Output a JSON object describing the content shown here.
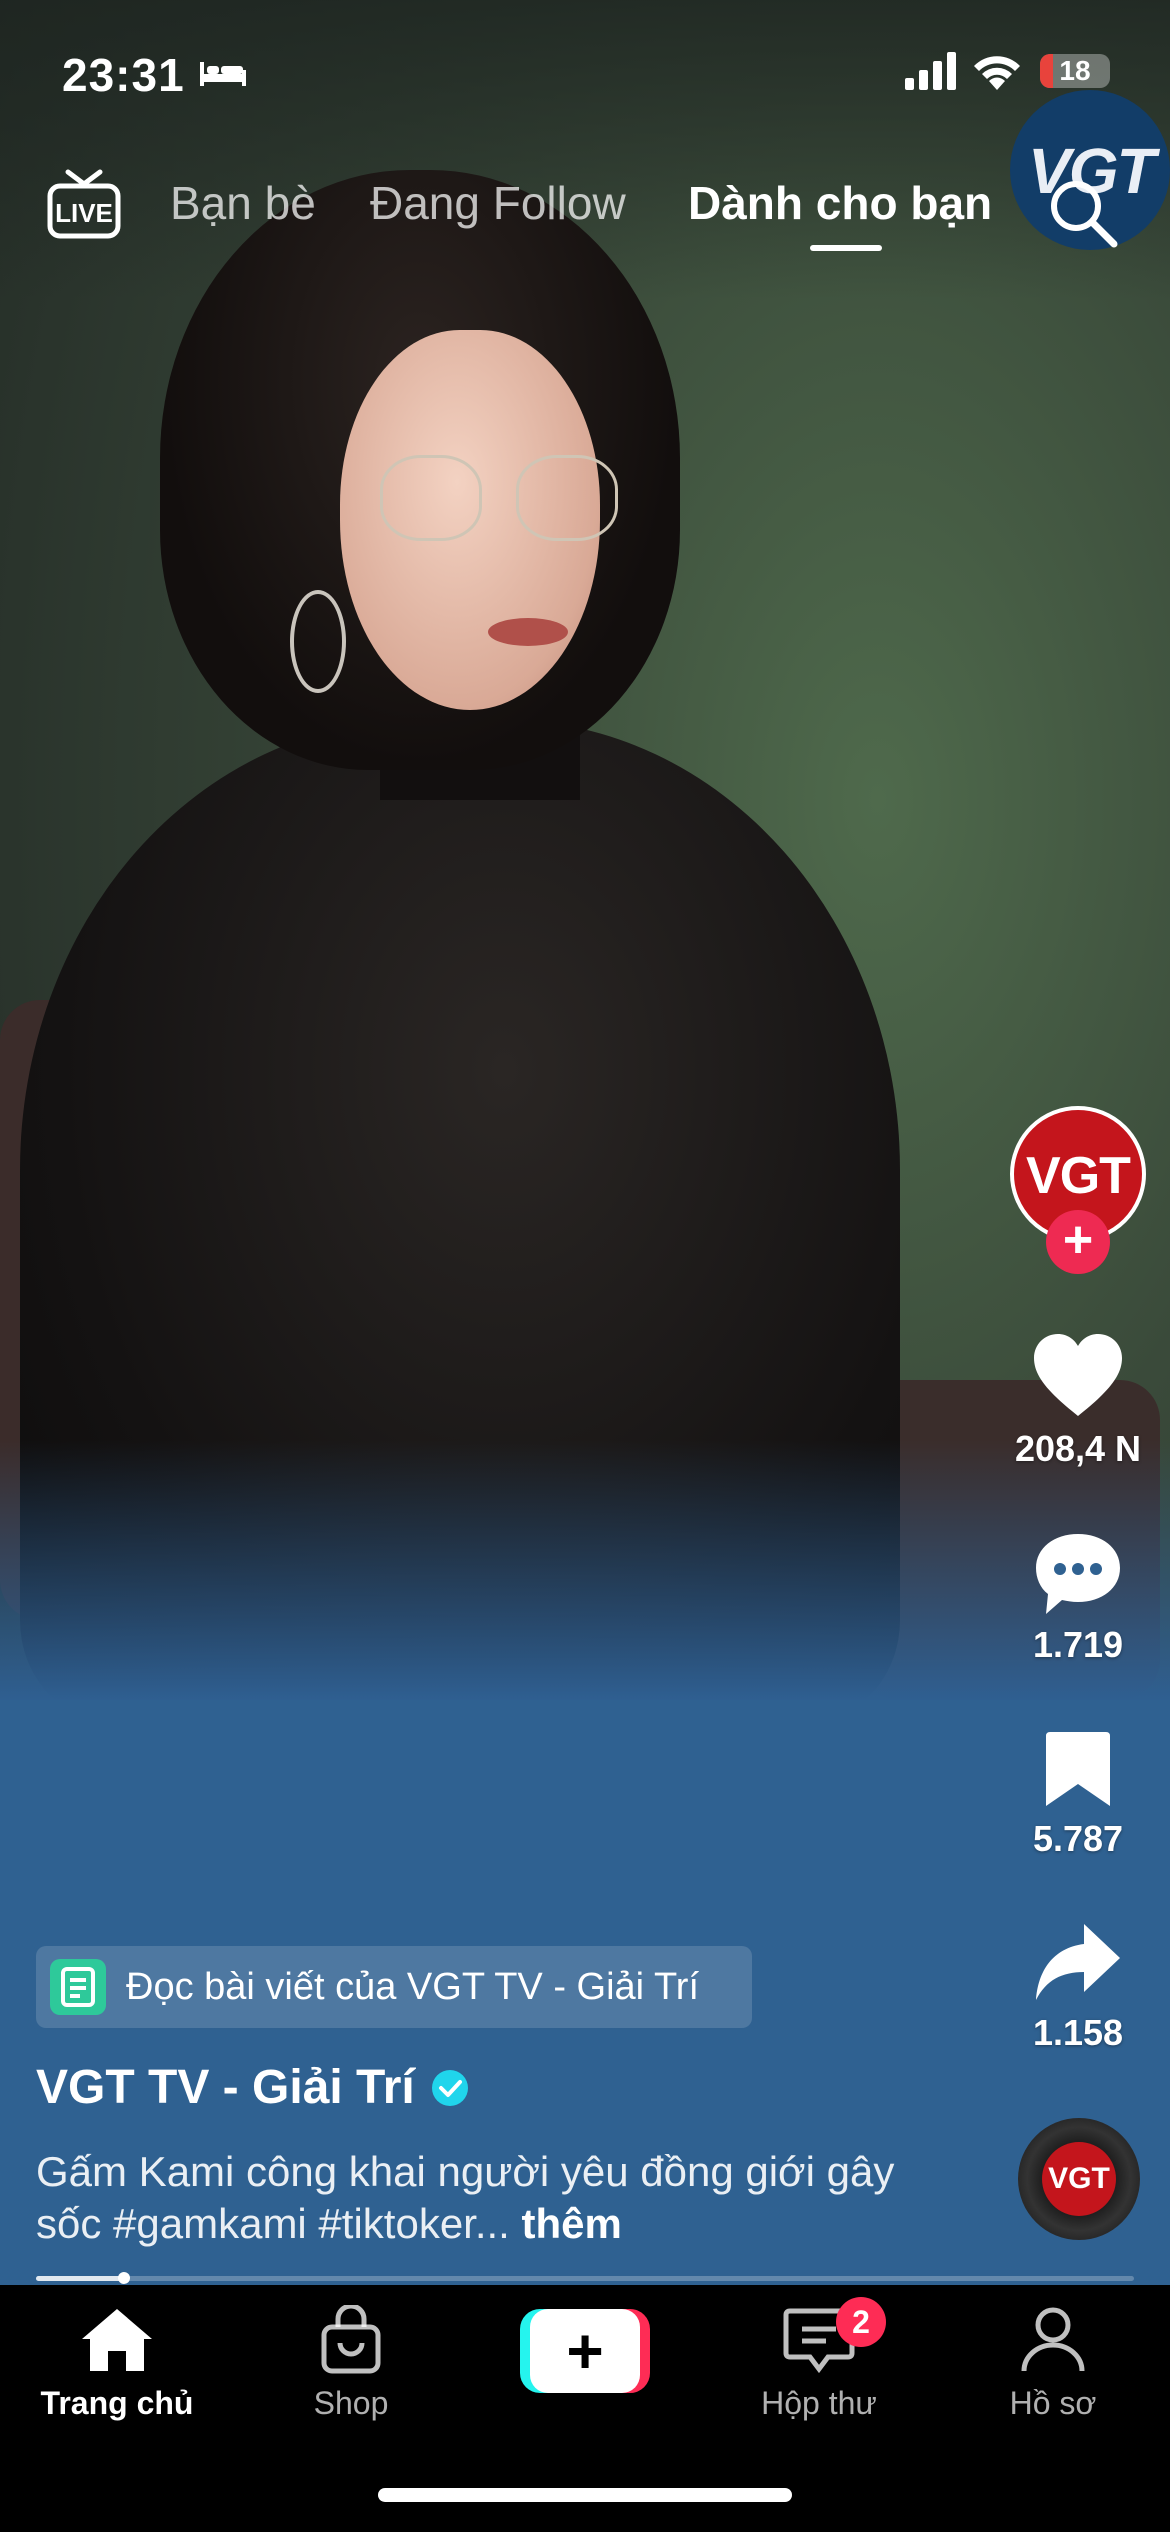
{
  "status_bar": {
    "time": "23:31",
    "battery_level": "18",
    "battery_fraction": 0.18,
    "icons": [
      "bed-icon",
      "cellular-signal-icon",
      "wifi-icon",
      "battery-icon"
    ]
  },
  "top_nav": {
    "live_label": "LIVE",
    "tabs": [
      {
        "label": "Bạn bè",
        "active": false
      },
      {
        "label": "Đang Follow",
        "active": false
      },
      {
        "label": "Dành cho bạn",
        "active": true
      }
    ],
    "watermark": "VGT",
    "search_icon": "search-icon"
  },
  "actions": {
    "avatar_text": "VGT",
    "follow_symbol": "+",
    "like_count": "208,4 N",
    "comment_count": "1.719",
    "bookmark_count": "5.787",
    "share_count": "1.158",
    "music_disc_text": "VGT"
  },
  "post": {
    "article_link": "Đọc bài viết của VGT TV - Giải Trí",
    "author": "VGT TV - Giải Trí",
    "caption": "Gấm Kami công khai người yêu đồng giới gây sốc #gamkami #tiktoker...",
    "more_label": "thêm",
    "progress": 0.08
  },
  "bottom_nav": {
    "items": [
      {
        "label": "Trang chủ",
        "icon": "home-icon",
        "active": true
      },
      {
        "label": "Shop",
        "icon": "shopping-bag-icon",
        "active": false
      },
      {
        "label": "",
        "icon": "create-plus-icon",
        "active": false
      },
      {
        "label": "Hộp thư",
        "icon": "inbox-icon",
        "active": false,
        "badge": "2"
      },
      {
        "label": "Hồ sơ",
        "icon": "profile-icon",
        "active": false
      }
    ]
  },
  "colors": {
    "accent_red": "#fe2c55",
    "accent_cyan": "#25f4ee",
    "brand_red": "#c4151c",
    "verified_blue": "#20d5ec",
    "article_green": "#2ec99a"
  }
}
